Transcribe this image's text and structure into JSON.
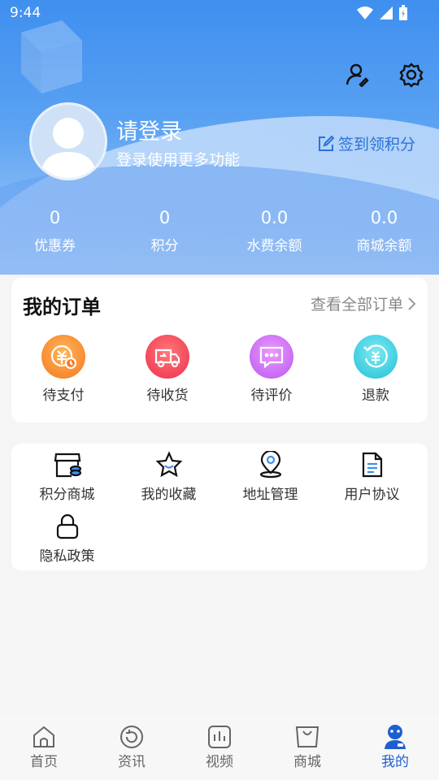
{
  "status_bar": {
    "time": "9:44"
  },
  "user": {
    "title": "请登录",
    "subtitle": "登录使用更多功能",
    "sign_in_label": "签到领积分"
  },
  "stats": [
    {
      "value": "0",
      "label": "优惠券"
    },
    {
      "value": "0",
      "label": "积分"
    },
    {
      "value": "0.0",
      "label": "水费余额"
    },
    {
      "value": "0.0",
      "label": "商城余额"
    }
  ],
  "orders": {
    "title": "我的订单",
    "view_all": "查看全部订单",
    "items": [
      {
        "label": "待支付",
        "icon": "pending-payment-icon",
        "color": "#f57c1f"
      },
      {
        "label": "待收货",
        "icon": "truck-icon",
        "color": "#f0394d"
      },
      {
        "label": "待评价",
        "icon": "comment-icon",
        "color": "#c45cf0"
      },
      {
        "label": "退款",
        "icon": "refund-icon",
        "color": "#27c7d9"
      }
    ]
  },
  "services": [
    {
      "label": "积分商城",
      "icon": "store-icon"
    },
    {
      "label": "我的收藏",
      "icon": "star-icon"
    },
    {
      "label": "地址管理",
      "icon": "location-pin-icon"
    },
    {
      "label": "用户协议",
      "icon": "document-icon"
    },
    {
      "label": "隐私政策",
      "icon": "lock-icon"
    }
  ],
  "bottom_nav": [
    {
      "label": "首页",
      "icon": "home-icon"
    },
    {
      "label": "资讯",
      "icon": "refresh-icon"
    },
    {
      "label": "视频",
      "icon": "video-chart-icon"
    },
    {
      "label": "商城",
      "icon": "shopping-bag-icon"
    },
    {
      "label": "我的",
      "icon": "profile-icon",
      "active": true
    }
  ],
  "colors": {
    "primary": "#3f8ff0",
    "nav_active": "#1e5fd0"
  }
}
